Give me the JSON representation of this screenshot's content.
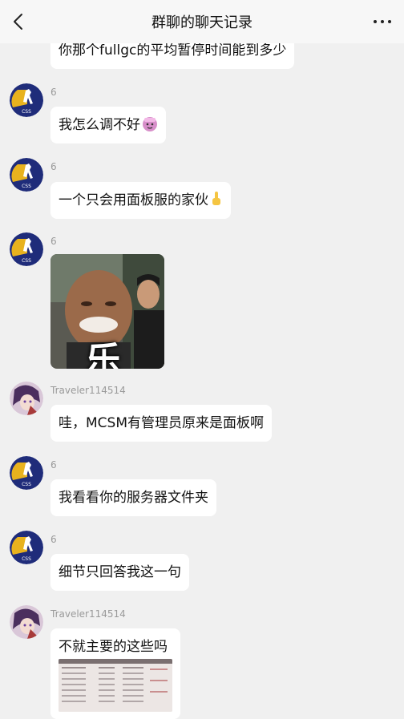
{
  "header": {
    "title": "群聊的聊天记录",
    "back_icon": "chevron-left-icon",
    "more_icon": "more-dots-icon"
  },
  "messages": [
    {
      "text": "你那个fullgc的平均暂停时间能到多少"
    },
    {
      "sender": "6",
      "text": "我怎么调不好",
      "emoji": "emoji-face-icon"
    },
    {
      "sender": "6",
      "text": "一个只会用面板服的家伙",
      "emoji": "pointing-finger-icon"
    },
    {
      "sender": "6",
      "sticker_text": "乐"
    },
    {
      "sender": "Traveler114514",
      "text": "哇，MCSM有管理员原来是面板啊"
    },
    {
      "sender": "6",
      "text": "我看看你的服务器文件夹"
    },
    {
      "sender": "6",
      "text": "细节只回答我这一句"
    },
    {
      "sender": "Traveler114514",
      "text": "不就主要的这些吗"
    }
  ],
  "colors": {
    "avatar_blue": "#1f2c7a",
    "avatar_gold": "#e8b21e",
    "bubble": "#ffffff",
    "background": "#f0f0f0"
  }
}
